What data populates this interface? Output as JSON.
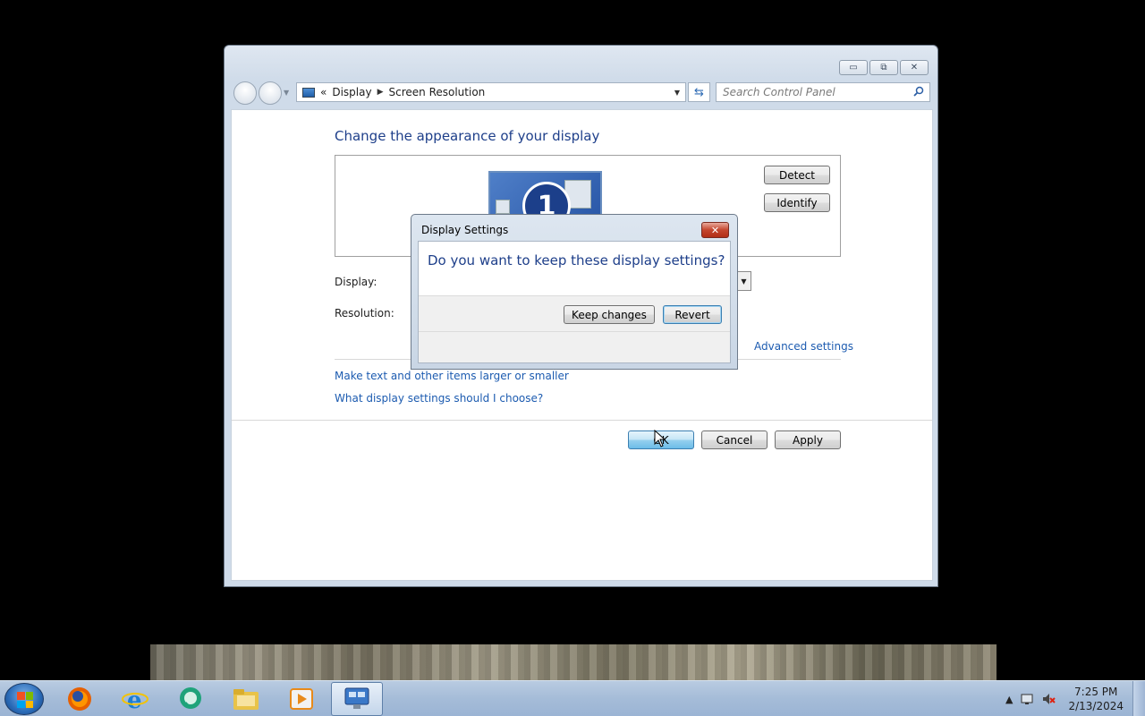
{
  "window": {
    "controls": {
      "minimize": "▭",
      "maximize": "⧉",
      "close": "✕"
    },
    "breadcrumb": {
      "prefix": "«",
      "part1": "Display",
      "part2": "Screen Resolution"
    },
    "search_placeholder": "Search Control Panel"
  },
  "screen_resolution": {
    "heading": "Change the appearance of your display",
    "monitor_number": "1",
    "detect_label": "Detect",
    "identify_label": "Identify",
    "display_label": "Display:",
    "resolution_label": "Resolution:",
    "advanced_settings": "Advanced settings",
    "link_text_size": "Make text and other items larger or smaller",
    "link_help": "What display settings should I choose?",
    "ok_label": "OK",
    "cancel_label": "Cancel",
    "apply_label": "Apply"
  },
  "dialog": {
    "title": "Display Settings",
    "question": "Do you want to keep these display settings?",
    "keep_label": "Keep changes",
    "revert_label": "Revert",
    "close_glyph": "✕"
  },
  "taskbar": {
    "time": "7:25 PM",
    "date": "2/13/2024",
    "apps": [
      "start-button",
      "firefox",
      "internet-explorer",
      "chat-app",
      "file-explorer",
      "media-player",
      "control-panel"
    ]
  },
  "colors": {
    "link": "#1c5bb0",
    "heading": "#1e3f8a",
    "taskbar": "#a5bcd8"
  }
}
